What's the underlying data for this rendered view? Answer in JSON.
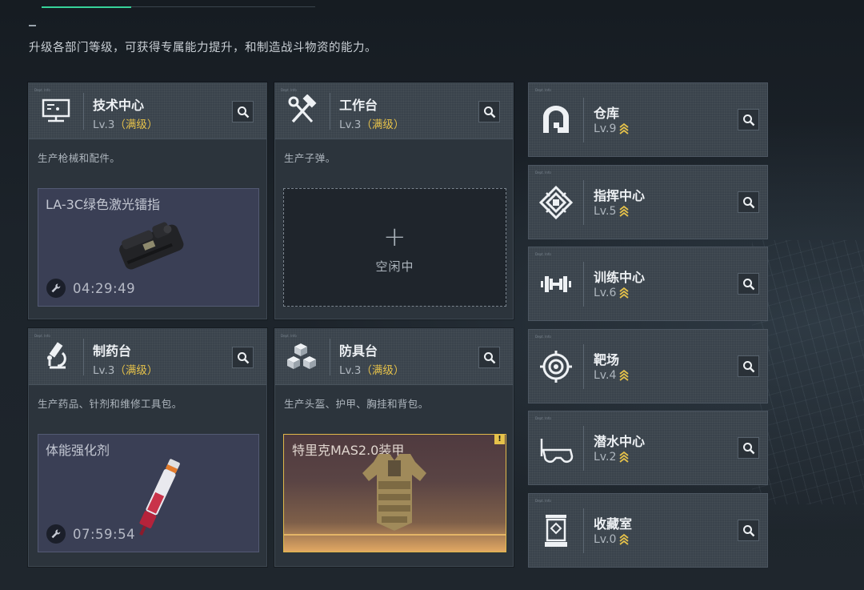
{
  "subtitle": "升级各部门等级，可获得专属能力提升，和制造战斗物资的能力。",
  "tiny_label": "Dept. Info",
  "main_cards": [
    {
      "name": "技术中心",
      "level": "Lv.3",
      "status": "（满级）",
      "desc": "生产枪械和配件。",
      "icon": "computer-icon",
      "slot": {
        "type": "producing",
        "item": "LA-3C绿色激光镭指",
        "timer": "04:29:49"
      }
    },
    {
      "name": "工作台",
      "level": "Lv.3",
      "status": "（满级）",
      "desc": "生产子弹。",
      "icon": "hammer-wrench-icon",
      "slot": {
        "type": "idle",
        "label": "空闲中"
      }
    },
    {
      "name": "制药台",
      "level": "Lv.3",
      "status": "（满级）",
      "desc": "生产药品、针剂和维修工具包。",
      "icon": "microscope-icon",
      "slot": {
        "type": "producing",
        "item": "体能强化剂",
        "timer": "07:59:54"
      }
    },
    {
      "name": "防具台",
      "level": "Lv.3",
      "status": "（满级）",
      "desc": "生产头盔、护甲、胸挂和背包。",
      "icon": "cubes-icon",
      "slot": {
        "type": "completed",
        "item": "特里克MAS2.0装甲",
        "flag": "!"
      }
    }
  ],
  "side_cards": [
    {
      "name": "仓库",
      "level": "Lv.9",
      "icon": "warehouse-icon"
    },
    {
      "name": "指挥中心",
      "level": "Lv.5",
      "icon": "command-emblem-icon"
    },
    {
      "name": "训练中心",
      "level": "Lv.6",
      "icon": "dumbbell-icon"
    },
    {
      "name": "靶场",
      "level": "Lv.4",
      "icon": "target-icon"
    },
    {
      "name": "潜水中心",
      "level": "Lv.2",
      "icon": "diving-mask-icon"
    },
    {
      "name": "收藏室",
      "level": "Lv.0",
      "icon": "display-case-icon"
    }
  ],
  "colors": {
    "accent": "#37d39a",
    "gold": "#e6c24a",
    "card": "#2c343c",
    "header": "#3a434c"
  }
}
